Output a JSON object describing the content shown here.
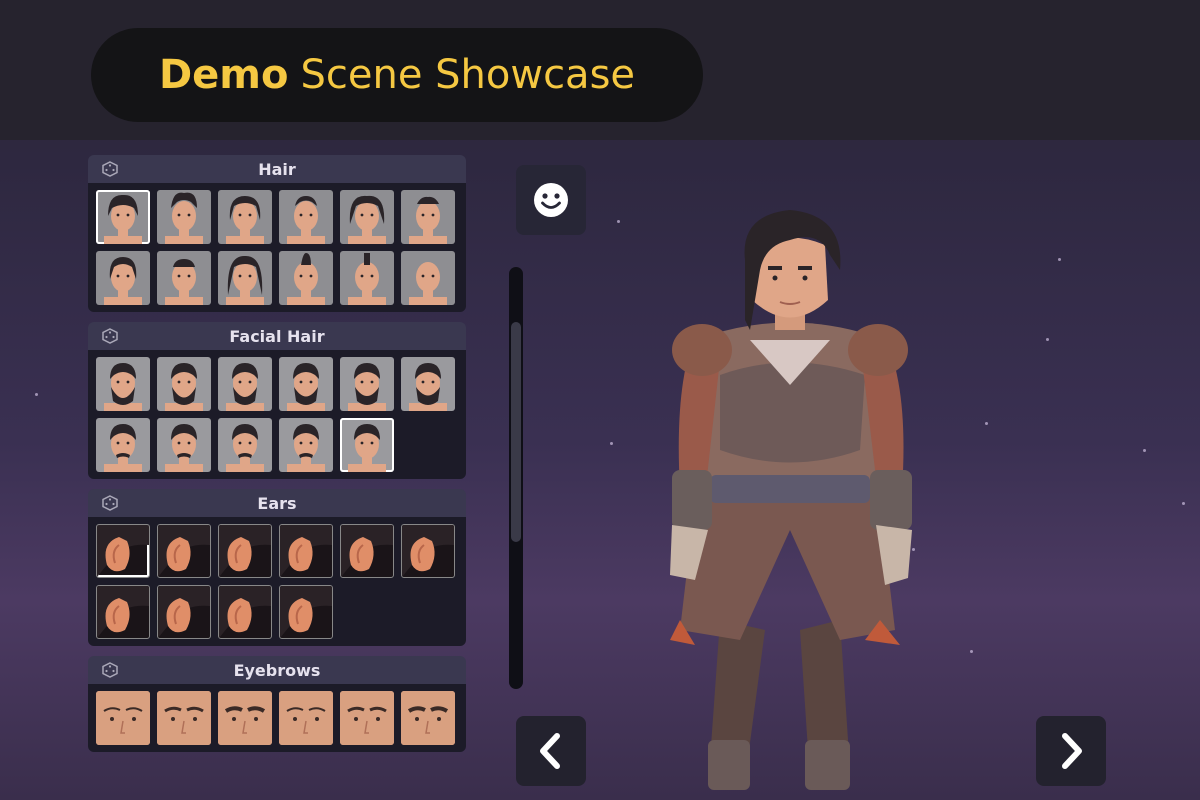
{
  "header": {
    "title_bold": "Demo",
    "title_rest": "Scene Showcase"
  },
  "colors": {
    "accent": "#f5c842",
    "panel_bg": "#1c1b28",
    "header_bg": "#3a3850"
  },
  "sections": [
    {
      "title": "Hair",
      "icon": "dice-icon",
      "count": 12,
      "selected": 0
    },
    {
      "title": "Facial Hair",
      "icon": "dice-icon",
      "count": 11,
      "selected": 10
    },
    {
      "title": "Ears",
      "icon": "dice-icon",
      "count": 10,
      "selected": 0
    },
    {
      "title": "Eyebrows",
      "icon": "dice-icon",
      "count": 6,
      "selected": -1
    }
  ],
  "controls": {
    "face_button_icon": "smiley-icon",
    "prev_icon": "chevron-left-icon",
    "next_icon": "chevron-right-icon"
  }
}
